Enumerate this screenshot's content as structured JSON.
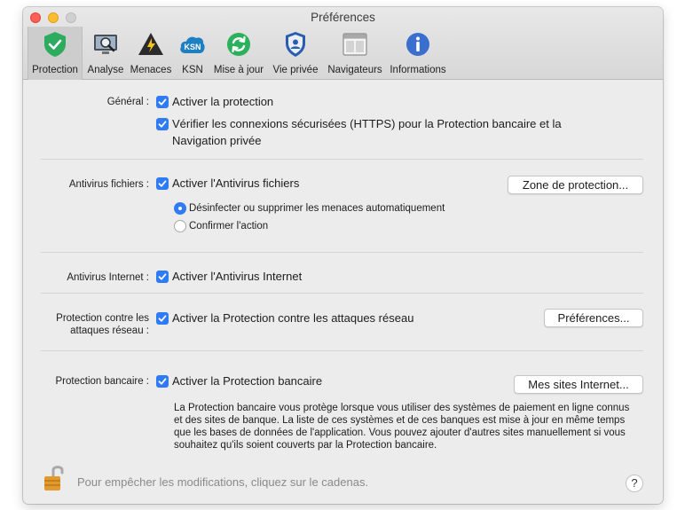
{
  "window": {
    "title": "Préférences"
  },
  "toolbar": {
    "items": [
      {
        "label": "Protection",
        "icon": "shield-check-icon",
        "selected": true
      },
      {
        "label": "Analyse",
        "icon": "scan-monitor-icon",
        "selected": false
      },
      {
        "label": "Menaces",
        "icon": "threat-warning-icon",
        "selected": false
      },
      {
        "label": "KSN",
        "icon": "ksn-cloud-icon",
        "selected": false
      },
      {
        "label": "Mise à jour",
        "icon": "update-icon",
        "selected": false
      },
      {
        "label": "Vie privée",
        "icon": "privacy-shield-icon",
        "selected": false
      },
      {
        "label": "Navigateurs",
        "icon": "browser-window-icon",
        "selected": false
      },
      {
        "label": "Informations",
        "icon": "info-icon",
        "selected": false
      }
    ]
  },
  "sections": {
    "general": {
      "label": "Général :",
      "enable_protection": "Activer la protection",
      "https_check_line1": "Vérifier les connexions sécurisées (HTTPS) pour la Protection bancaire et la",
      "https_check_line2": "Navigation privée"
    },
    "file_antivirus": {
      "label": "Antivirus fichiers :",
      "enable": "Activer l'Antivirus fichiers",
      "zone_button": "Zone de protection...",
      "option_auto": "Désinfecter ou supprimer les menaces automatiquement",
      "option_confirm": "Confirmer l'action",
      "selected_option": "Désinfecter ou supprimer les menaces automatiquement"
    },
    "web_antivirus": {
      "label": "Antivirus Internet :",
      "enable": "Activer l'Antivirus Internet"
    },
    "network_attack": {
      "label_line1": "Protection contre les",
      "label_line2": "attaques réseau :",
      "enable": "Activer la Protection contre les attaques réseau",
      "prefs_button": "Préférences..."
    },
    "safe_money": {
      "label": "Protection bancaire :",
      "enable": "Activer la Protection bancaire",
      "sites_button": "Mes sites Internet...",
      "description_line1": "La Protection bancaire vous protège lorsque vous utiliser des systèmes de paiement en ligne connus",
      "description_line2": "et des sites de banque. La liste de ces systèmes et de ces banques est mise à jour en même temps",
      "description_line3": "que les bases de données de l'application. Vous pouvez ajouter d'autres sites manuellement si vous",
      "description_line4": "souhaitez qu'ils soient couverts par la Protection bancaire."
    }
  },
  "footer": {
    "lock_text": "Pour empêcher les modifications, cliquez sur le cadenas.",
    "help_label": "?"
  },
  "colors": {
    "accent": "#2f7bf5",
    "protection_green": "#2dab5f"
  }
}
